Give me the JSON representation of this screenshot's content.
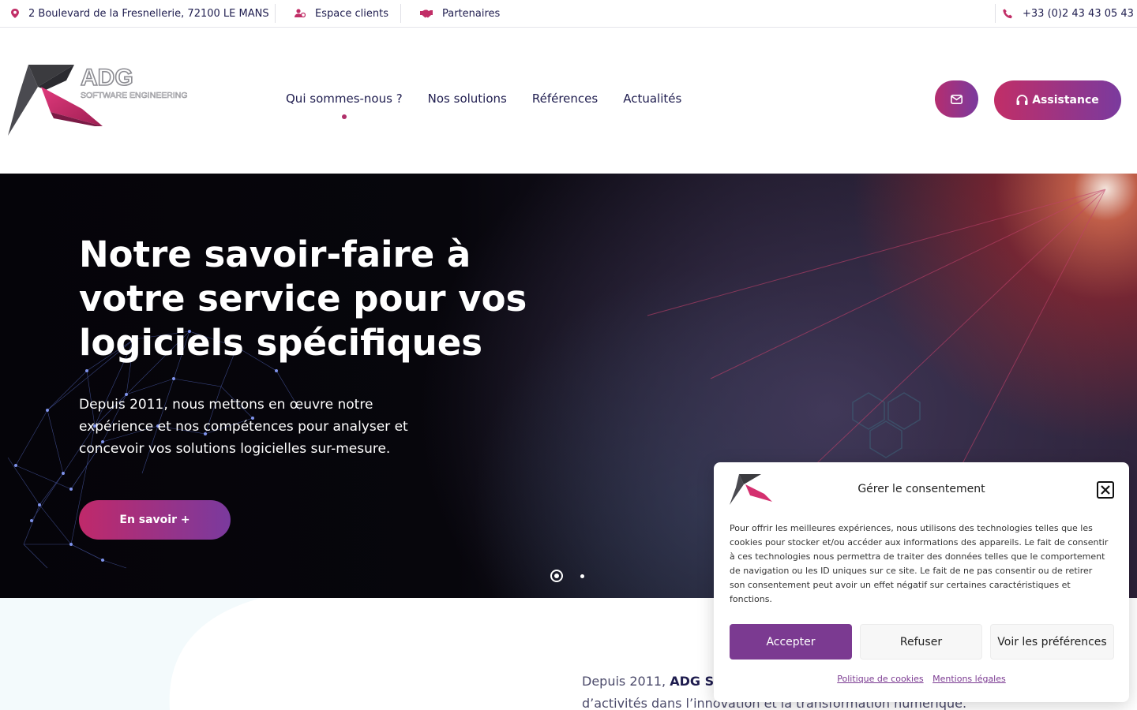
{
  "topbar": {
    "address": "2 Boulevard de la Fresnellerie, 72100 LE MANS",
    "client_space": "Espace clients",
    "partners": "Partenaires",
    "phone": "+33 (0)2 43 43 05 43"
  },
  "header": {
    "logo_text": "ADG",
    "logo_tagline": "SOFTWARE ENGINEERING",
    "nav": [
      "Qui sommes-nous ?",
      "Nos solutions",
      "Références",
      "Actualités"
    ],
    "assistance_label": "Assistance"
  },
  "hero": {
    "title": "Notre savoir-faire à votre service pour vos logiciels spécifiques",
    "subtitle": "Depuis 2011, nous mettons en œuvre notre expérience et nos compétences pour analyser et concevoir vos solutions logicielles sur-mesure.",
    "cta": "En savoir +"
  },
  "intro": {
    "prefix": "Depuis 2011, ",
    "company": "ADG Sof",
    "line2": "d’activités dans l’innovation et la transformation numérique."
  },
  "cookie": {
    "title": "Gérer le consentement",
    "text": "Pour offrir les meilleures expériences, nous utilisons des technologies telles que les cookies pour stocker et/ou accéder aux informations des appareils. Le fait de consentir à ces technologies nous permettra de traiter des données telles que le comportement de navigation ou les ID uniques sur ce site. Le fait de ne pas consentir ou de retirer son consentement peut avoir un effet négatif sur certaines caractéristiques et fonctions.",
    "accept": "Accepter",
    "refuse": "Refuser",
    "preferences": "Voir les préférences",
    "policy_link": "Politique de cookies",
    "legal_link": "Mentions légales"
  },
  "colors": {
    "brand_navy": "#1f1d4f",
    "brand_pink": "#c12e67",
    "brand_purple": "#7a3a9e",
    "accept_purple": "#7b3a91"
  },
  "icons": [
    "map-pin-icon",
    "user-group-icon",
    "handshake-icon",
    "phone-icon",
    "mail-icon",
    "headset-icon",
    "close-icon"
  ]
}
